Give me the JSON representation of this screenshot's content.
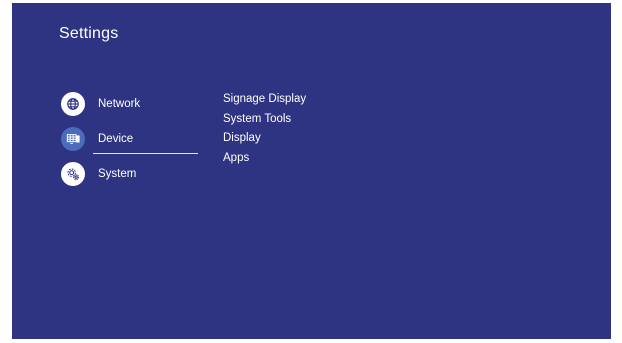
{
  "header": {
    "title": "Settings"
  },
  "sidebar": {
    "items": [
      {
        "label": "Network",
        "icon": "globe-icon",
        "selected": false
      },
      {
        "label": "Device",
        "icon": "display-grid-icon",
        "selected": true
      },
      {
        "label": "System",
        "icon": "gear-icon",
        "selected": false
      }
    ]
  },
  "submenu": {
    "items": [
      {
        "label": "Signage Display"
      },
      {
        "label": "System Tools"
      },
      {
        "label": "Display"
      },
      {
        "label": "Apps"
      }
    ]
  },
  "colors": {
    "background": "#2e3482",
    "accent_icon": "#4c6bbd",
    "text": "#ffffff"
  }
}
